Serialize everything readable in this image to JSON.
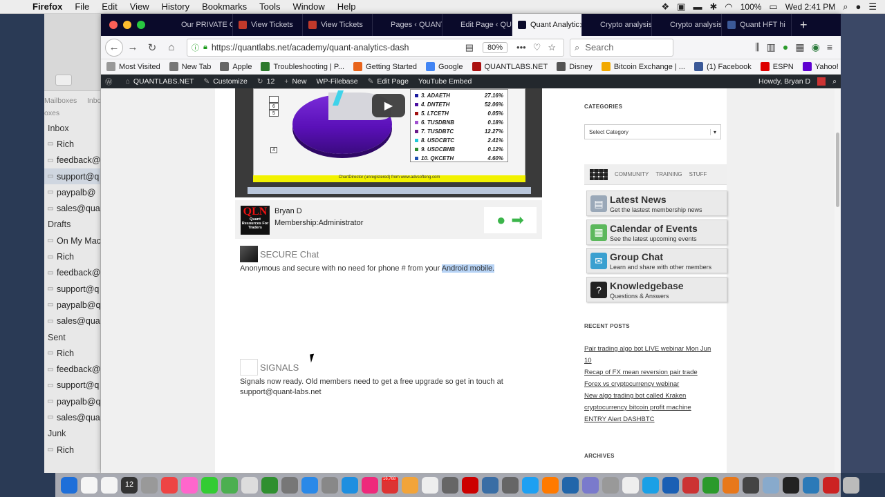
{
  "menubar": {
    "app": "Firefox",
    "items": [
      "File",
      "Edit",
      "View",
      "History",
      "Bookmarks",
      "Tools",
      "Window",
      "Help"
    ],
    "battery": "100%",
    "clock": "Wed 2:41 PM"
  },
  "mail": {
    "toolbar_labels": [
      "Mailboxes",
      "Inbo"
    ],
    "section_header": "oxes",
    "rows": [
      {
        "label": "Inbox",
        "type": "sect"
      },
      {
        "label": "Rich",
        "type": "item"
      },
      {
        "label": "feedback@",
        "type": "item"
      },
      {
        "label": "support@q",
        "type": "item",
        "selected": true
      },
      {
        "label": "paypalb@",
        "type": "item"
      },
      {
        "label": "sales@qua",
        "type": "item"
      },
      {
        "label": "Drafts",
        "type": "sect"
      },
      {
        "label": "On My Mac",
        "type": "item"
      },
      {
        "label": "Rich",
        "type": "item"
      },
      {
        "label": "feedback@",
        "type": "item"
      },
      {
        "label": "support@q",
        "type": "item"
      },
      {
        "label": "paypalb@q",
        "type": "item"
      },
      {
        "label": "sales@qua",
        "type": "item"
      },
      {
        "label": "Sent",
        "type": "sect"
      },
      {
        "label": "Rich",
        "type": "item"
      },
      {
        "label": "feedback@",
        "type": "item"
      },
      {
        "label": "support@q",
        "type": "item"
      },
      {
        "label": "paypalb@q",
        "type": "item"
      },
      {
        "label": "sales@qua",
        "type": "item"
      },
      {
        "label": "Junk",
        "type": "sect"
      },
      {
        "label": "Rich",
        "type": "item"
      }
    ]
  },
  "tabs": [
    {
      "label": "Our PRIVATE Cha",
      "color": "#0a0a2a"
    },
    {
      "label": "View Tickets",
      "color": "#c0392b"
    },
    {
      "label": "View Tickets",
      "color": "#c0392b"
    },
    {
      "label": "Pages ‹ QUANTL",
      "color": "#0a0a2a"
    },
    {
      "label": "Edit Page ‹ QUAN",
      "color": "#0a0a2a"
    },
    {
      "label": "Quant Analytic",
      "color": "#0a0a2a",
      "active": true
    },
    {
      "label": "Crypto analysis c",
      "color": "#0a0a2a"
    },
    {
      "label": "Crypto analysis c",
      "color": "#0a0a2a"
    },
    {
      "label": "Quant HFT hi",
      "color": "#3b5998"
    }
  ],
  "navbar": {
    "url": "https://quantlabs.net/academy/quant-analytics-dash",
    "zoom": "80%",
    "search_placeholder": "Search"
  },
  "bookmarks": [
    {
      "label": "Most Visited",
      "color": "#999"
    },
    {
      "label": "New Tab",
      "color": "#777"
    },
    {
      "label": "Apple",
      "color": "#666"
    },
    {
      "label": "Troubleshooting | P...",
      "color": "#2d7a2d"
    },
    {
      "label": "Getting Started",
      "color": "#e8641b"
    },
    {
      "label": "Google",
      "color": "#4285f4"
    },
    {
      "label": "QUANTLABS.NET",
      "color": "#a11"
    },
    {
      "label": "Disney",
      "color": "#555"
    },
    {
      "label": "Bitcoin Exchange | ...",
      "color": "#f2a900"
    },
    {
      "label": "(1) Facebook",
      "color": "#3b5998"
    },
    {
      "label": "ESPN",
      "color": "#d00"
    },
    {
      "label": "Yahoo!",
      "color": "#5f01d1"
    }
  ],
  "wpbar": {
    "site": "QUANTLABS.NET",
    "customize": "Customize",
    "updates": "12",
    "new": "New",
    "filebase": "WP-Filebase",
    "edit": "Edit Page",
    "embed": "YouTube Embed",
    "howdy": "Howdy, Bryan D"
  },
  "video": {
    "legend": [
      {
        "num": "3.",
        "name": "ADAETH",
        "pct": "27.16%",
        "color": "#1b1b9e"
      },
      {
        "num": "4.",
        "name": "DNTETH",
        "pct": "52.06%",
        "color": "#4a0fa0"
      },
      {
        "num": "5.",
        "name": "LTCETH",
        "pct": "0.05%",
        "color": "#a01010"
      },
      {
        "num": "6.",
        "name": "TUSDBNB",
        "pct": "0.18%",
        "color": "#a04fd0"
      },
      {
        "num": "7.",
        "name": "TUSDBTC",
        "pct": "12.27%",
        "color": "#6a1a8a"
      },
      {
        "num": "8.",
        "name": "USDCBTC",
        "pct": "2.41%",
        "color": "#20c8d8"
      },
      {
        "num": "9.",
        "name": "USDCBNB",
        "pct": "0.12%",
        "color": "#2e8b2e"
      },
      {
        "num": "10.",
        "name": "QKCETH",
        "pct": "4.60%",
        "color": "#1f4fb0"
      }
    ],
    "pie_labels": [
      "6",
      "5"
    ],
    "pie_label_4": "4",
    "watermark": "ChartDirector (unregistered) from www.advsofteng.com"
  },
  "user": {
    "logo_text": "QLN",
    "logo_sub": "Quant Resources For Traders",
    "name": "Bryan D",
    "role": "Membership:Administrator"
  },
  "secure": {
    "title": "SECURE Chat",
    "body_prefix": "Anonymous and secure with no need for phone # from your ",
    "body_highlight": "Android mobile."
  },
  "signals": {
    "title": "SIGNALS",
    "body": "Signals now ready. Old members need to get a free upgrade so get in touch at support@quant-labs.net"
  },
  "sidebar": {
    "categories_title": "CATEGORIES",
    "select_value": "Select Category",
    "community_tabs": [
      "COMMUNITY",
      "TRAINING",
      "STUFF"
    ],
    "community_items": [
      {
        "title": "Latest News",
        "sub": "Get the lastest membership news",
        "color": "#9aa8b8"
      },
      {
        "title": "Calendar of Events",
        "sub": "See the latest upcoming events",
        "color": "#5cb85c"
      },
      {
        "title": "Group Chat",
        "sub": "Learn and share with other members",
        "color": "#3aa0d0"
      },
      {
        "title": "Knowledgebase",
        "sub": "Questions & Answers",
        "color": "#222"
      }
    ],
    "recent_title": "RECENT POSTS",
    "recent_posts": [
      "Pair trading algo bot LIVE webinar Mon Jun 10",
      "Recap of FX mean reversion pair trade",
      "Forex vs cryptocurrency webinar",
      "New algo trading bot called Kraken cryptocurrency bitcoin profit machine",
      "ENTRY Alert DASHBTC"
    ],
    "archives_title": "ARCHIVES"
  },
  "dock_badges": {
    "calendar": "12",
    "mail": "16,768"
  }
}
